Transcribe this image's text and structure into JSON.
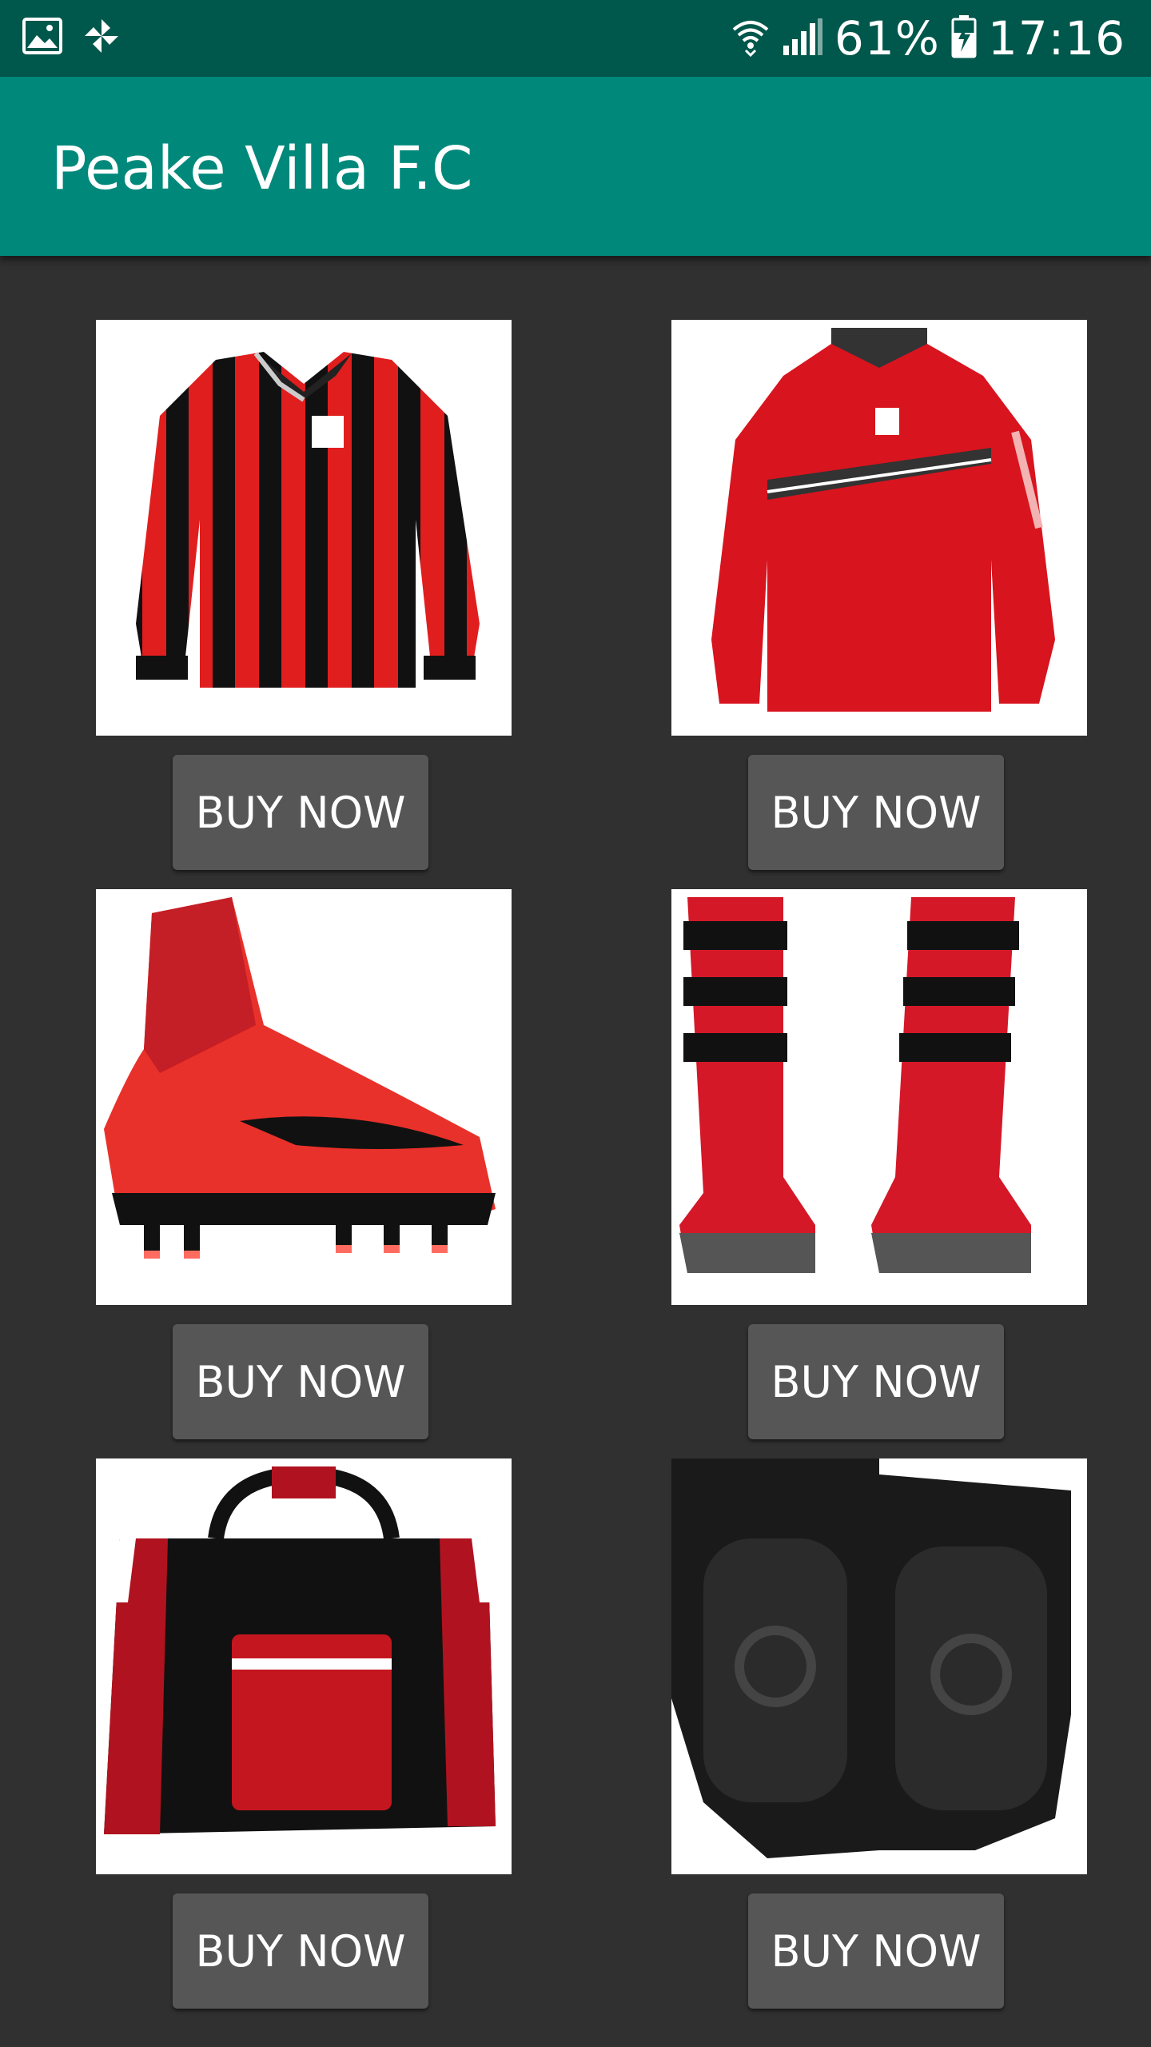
{
  "status_bar": {
    "battery": "61%",
    "time": "17:16",
    "icons": [
      "gallery-icon",
      "pinwheel-icon",
      "wifi-icon",
      "signal-icon",
      "battery-charging-icon"
    ]
  },
  "app_bar": {
    "title": "Peake Villa F.C"
  },
  "products": [
    {
      "image": "striped-long-sleeve-shirt",
      "button_label": "BUY NOW"
    },
    {
      "image": "red-training-top",
      "button_label": "BUY NOW"
    },
    {
      "image": "red-football-boot",
      "button_label": "BUY NOW"
    },
    {
      "image": "striped-football-socks",
      "button_label": "BUY NOW"
    },
    {
      "image": "red-black-kit-bag",
      "button_label": "BUY NOW"
    },
    {
      "image": "black-shin-guards",
      "button_label": "BUY NOW"
    }
  ],
  "colors": {
    "status_bar": "#00574B",
    "app_bar": "#00897B",
    "background": "#303030",
    "button": "#565656",
    "kit_red": "#E01E1E",
    "kit_black": "#111111"
  }
}
